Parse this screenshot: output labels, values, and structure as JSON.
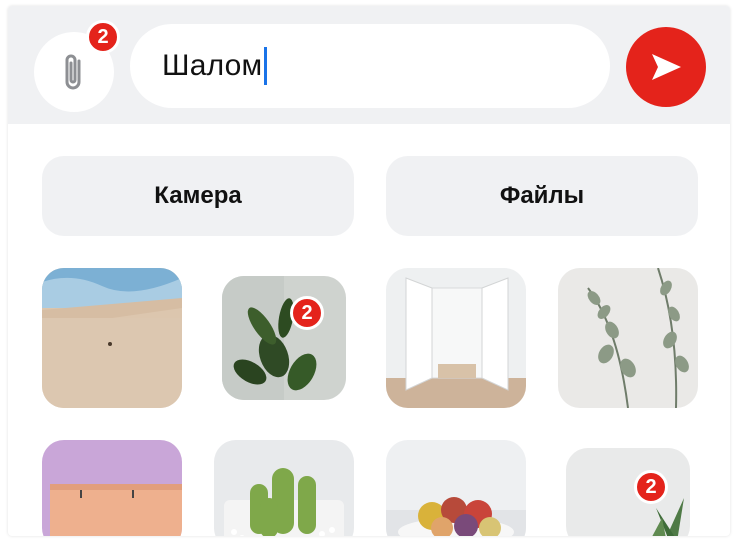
{
  "composer": {
    "attach_count": "2",
    "message_text": "Шалом"
  },
  "actions": {
    "camera_label": "Камера",
    "files_label": "Файлы"
  },
  "gallery": {
    "items": [
      {
        "name": "desert-sand",
        "selected_index": null
      },
      {
        "name": "green-plant",
        "selected_index": "2"
      },
      {
        "name": "white-doors-room",
        "selected_index": null
      },
      {
        "name": "eucalyptus-branch",
        "selected_index": null
      },
      {
        "name": "pink-building",
        "selected_index": null
      },
      {
        "name": "cactus-pot",
        "selected_index": null
      },
      {
        "name": "fruit-bowl",
        "selected_index": null
      },
      {
        "name": "aloe-plant",
        "selected_index": "2"
      }
    ]
  },
  "colors": {
    "accent": "#e4231b",
    "surface": "#f0f1f3",
    "caret": "#1a73e8"
  },
  "icons": {
    "attach": "paperclip-icon",
    "send": "send-arrow-icon"
  }
}
